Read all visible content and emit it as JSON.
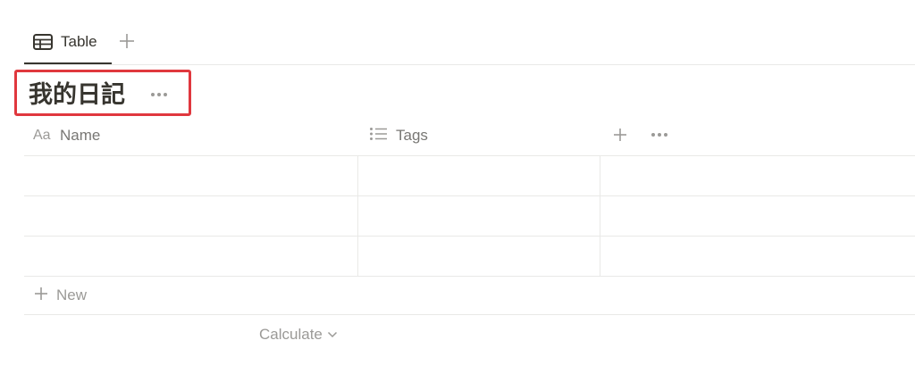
{
  "views": {
    "tabs": [
      {
        "label": "Table",
        "icon": "table-icon",
        "active": true
      }
    ],
    "add_icon": "plus-icon"
  },
  "database": {
    "title": "我的日記",
    "title_more_icon": "more-horizontal-icon"
  },
  "table": {
    "columns": [
      {
        "label": "Name",
        "icon_text": "Aa",
        "icon": "text-property-icon"
      },
      {
        "label": "Tags",
        "icon": "multi-select-list-icon"
      }
    ],
    "add_property_icon": "plus-icon",
    "more_icon": "more-horizontal-icon",
    "rows": [
      {
        "name": "",
        "tags": ""
      },
      {
        "name": "",
        "tags": ""
      },
      {
        "name": "",
        "tags": ""
      }
    ],
    "new_row_label": "New",
    "calculate_label": "Calculate"
  },
  "colors": {
    "text": "#37352f",
    "muted_text": "#787774",
    "faint_text": "#9b9a97",
    "divider": "#e9e9e7",
    "highlight_box": "#e0383e"
  }
}
